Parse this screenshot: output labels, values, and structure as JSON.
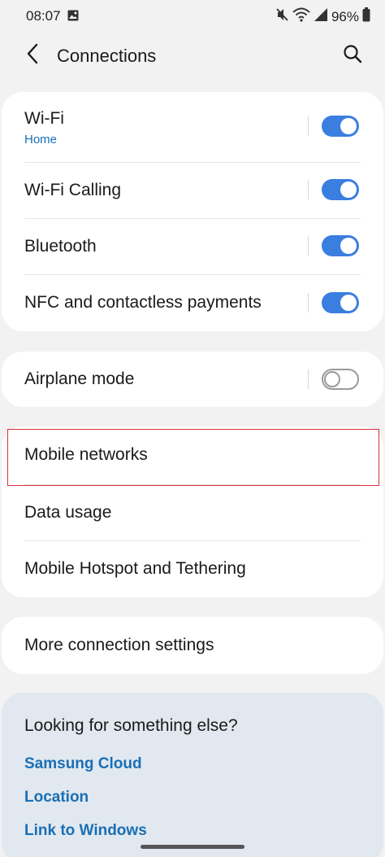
{
  "status_bar": {
    "time": "08:07",
    "battery": "96%"
  },
  "header": {
    "title": "Connections"
  },
  "main": {
    "group1": [
      {
        "label": "Wi-Fi",
        "sub": "Home",
        "toggle": true
      },
      {
        "label": "Wi-Fi Calling",
        "toggle": true
      },
      {
        "label": "Bluetooth",
        "toggle": true
      },
      {
        "label": "NFC and contactless payments",
        "toggle": true
      }
    ],
    "group2": [
      {
        "label": "Airplane mode",
        "toggle": false
      }
    ],
    "group3": [
      {
        "label": "Mobile networks"
      },
      {
        "label": "Data usage"
      },
      {
        "label": "Mobile Hotspot and Tethering"
      }
    ],
    "group4": [
      {
        "label": "More connection settings"
      }
    ]
  },
  "suggestions": {
    "title": "Looking for something else?",
    "links": [
      "Samsung Cloud",
      "Location",
      "Link to Windows"
    ]
  },
  "colors": {
    "accent": "#3a7ee0",
    "link": "#1a6fb5",
    "highlight": "#d9303a"
  }
}
